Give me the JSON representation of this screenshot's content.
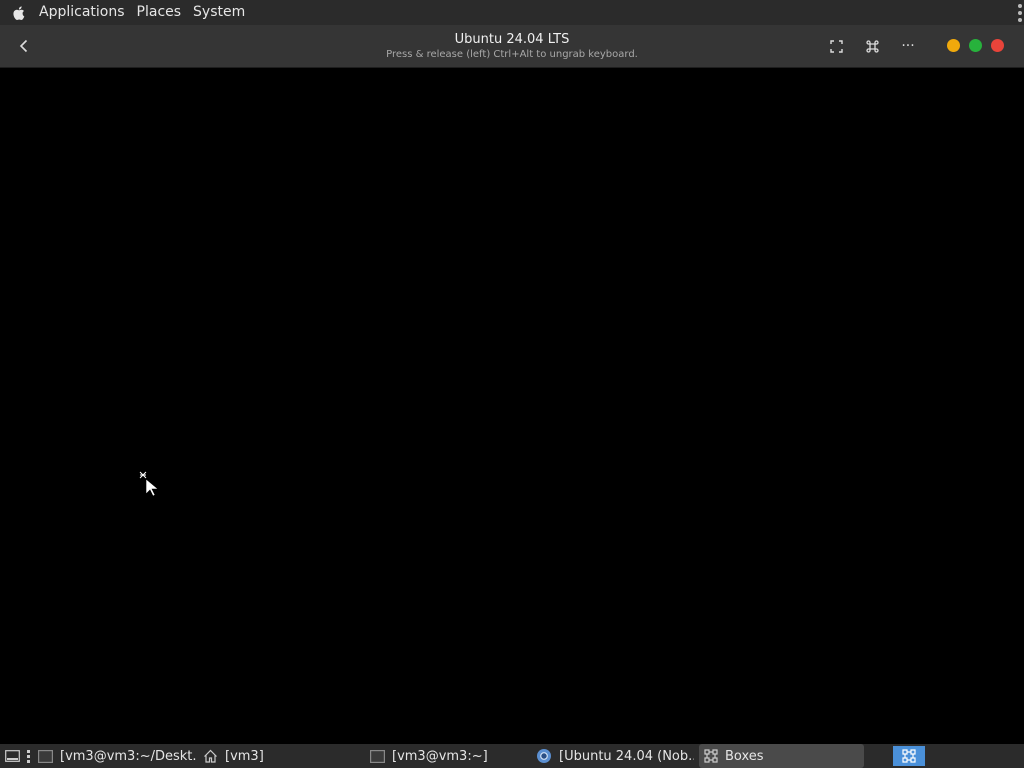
{
  "top_panel": {
    "menus": [
      "Applications",
      "Places",
      "System"
    ]
  },
  "header": {
    "title": "Ubuntu 24.04 LTS",
    "subtitle": "Press & release (left) Ctrl+Alt to ungrab keyboard.",
    "more_label": "···"
  },
  "window_controls": {
    "minimize_color": "#f0a90c",
    "maximize_color": "#27b23c",
    "close_color": "#e8443a"
  },
  "taskbar": {
    "items": [
      {
        "label": "[vm3@vm3:~/Deskt...",
        "icon": "terminal-icon"
      },
      {
        "label": "[vm3]",
        "icon": "home-folder-icon"
      },
      {
        "label": "[vm3@vm3:~]",
        "icon": "terminal-icon"
      },
      {
        "label": "[Ubuntu 24.04 (Nob...",
        "icon": "chromium-icon"
      },
      {
        "label": "Boxes",
        "icon": "boxes-icon",
        "active": true
      }
    ],
    "workspace_color": "#4a90d9"
  }
}
